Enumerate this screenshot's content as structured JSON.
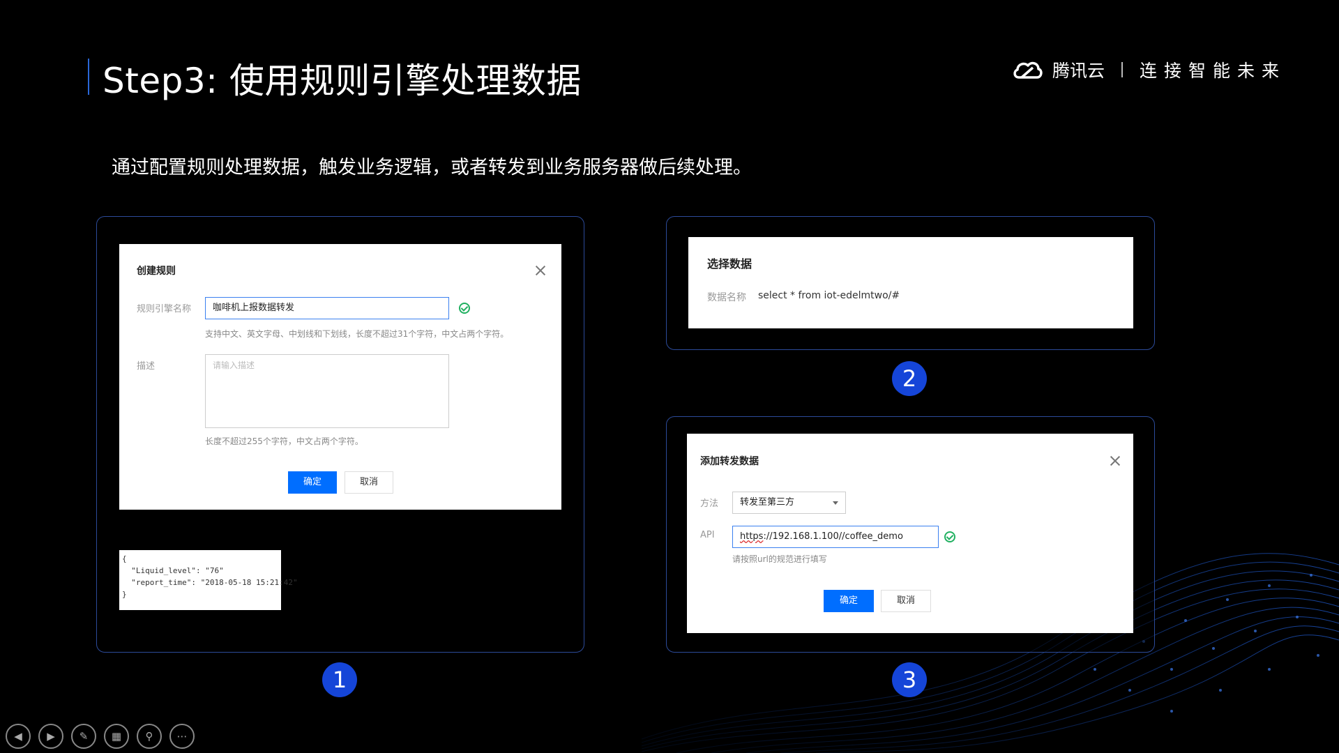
{
  "header": {
    "title": "Step3: 使用规则引擎处理数据",
    "brand": "腾讯云",
    "slogan": "连接智能未来"
  },
  "subtitle": "通过配置规则处理数据，触发业务逻辑，或者转发到业务服务器做后续处理。",
  "panel1": {
    "dialog_title": "创建规则",
    "name_label": "规则引擎名称",
    "name_value": "咖啡机上报数据转发",
    "name_hint": "支持中文、英文字母、中划线和下划线，长度不超过31个字符，中文占两个字符。",
    "desc_label": "描述",
    "desc_placeholder": "请输入描述",
    "desc_hint": "长度不超过255个字符，中文占两个字符。",
    "ok_label": "确定",
    "cancel_label": "取消",
    "json_lines": [
      "{",
      "  \"Liquid_level\": \"76\"",
      "  \"report_time\": \"2018-05-18 15:21:42\"",
      "}"
    ],
    "step_number": "1"
  },
  "panel2": {
    "dialog_title": "选择数据",
    "field_label": "数据名称",
    "field_value": "select * from iot-edelmtwo/#",
    "step_number": "2"
  },
  "panel3": {
    "dialog_title": "添加转发数据",
    "method_label": "方法",
    "method_value": "转发至第三方",
    "api_label": "API",
    "api_value_prefix": "https",
    "api_value_rest": "://192.168.1.100//coffee_demo",
    "api_hint": "请按照url的规范进行填写",
    "ok_label": "确定",
    "cancel_label": "取消",
    "step_number": "3"
  },
  "colors": {
    "accent": "#006eff",
    "panel_border": "#2c4b9a",
    "step_badge": "#1545d8",
    "valid_green": "#20b060"
  },
  "controls": {
    "icons": [
      "prev-icon",
      "next-icon",
      "pen-icon",
      "slides-icon",
      "zoom-icon",
      "more-icon"
    ]
  }
}
